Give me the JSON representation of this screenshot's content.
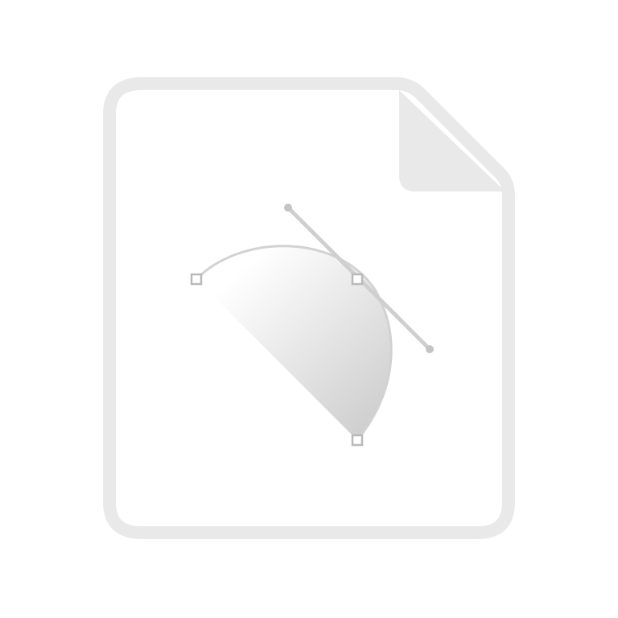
{
  "icon": {
    "name": "vector-file-icon",
    "colors": {
      "page_outline": "#e9e9e9",
      "page_fill": "#ffffff",
      "curve_stroke": "#d2d2d2",
      "handle_line": "#cfcfcf",
      "handle_dot": "#c4c4c4",
      "anchor_stroke": "#b9b9b9",
      "gradient_start": "#ffffff",
      "gradient_end": "#cccccc"
    }
  }
}
